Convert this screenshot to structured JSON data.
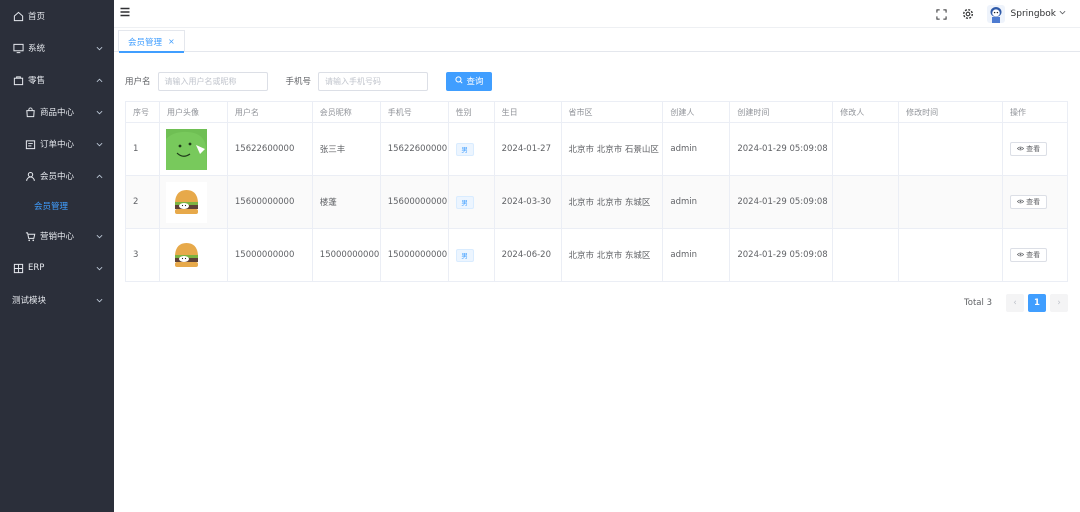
{
  "sidebar": {
    "items": [
      {
        "label": "首页",
        "icon": "home-icon"
      },
      {
        "label": "系统",
        "icon": "monitor-icon"
      },
      {
        "label": "零售",
        "icon": "bag-icon"
      },
      {
        "label": "商品中心",
        "icon": "shop-icon"
      },
      {
        "label": "订单中心",
        "icon": "order-icon"
      },
      {
        "label": "会员中心",
        "icon": "user-icon"
      },
      {
        "label": "会员管理",
        "icon": ""
      },
      {
        "label": "营销中心",
        "icon": "cart-icon"
      },
      {
        "label": "ERP",
        "icon": "erp-icon"
      },
      {
        "label": "测试模块",
        "icon": ""
      }
    ]
  },
  "header": {
    "user_name": "Springbok",
    "icons": [
      "hamburger-icon",
      "fullscreen-icon",
      "settings-icon",
      "chevron-down-icon"
    ]
  },
  "tabs": [
    {
      "label": "会员管理",
      "close": "×"
    }
  ],
  "search": {
    "username_label": "用户名",
    "username_placeholder": "请输入用户名或昵称",
    "phone_label": "手机号",
    "phone_placeholder": "请输入手机号码",
    "button_label": "查询"
  },
  "table": {
    "columns": [
      "序号",
      "用户头像",
      "用户名",
      "会员昵称",
      "手机号",
      "性别",
      "生日",
      "省市区",
      "创建人",
      "创建时间",
      "修改人",
      "修改时间",
      "操作"
    ],
    "rows": [
      {
        "index": "1",
        "avatar": "dino",
        "username": "15622600000",
        "nickname": "张三丰",
        "phone": "15622600000",
        "gender": "男",
        "birthday": "2024-01-27",
        "region": "北京市 北京市 石景山区",
        "creator": "admin",
        "created": "2024-01-29 05:09:08",
        "modifier": "",
        "modified": "",
        "action": "查看"
      },
      {
        "index": "2",
        "avatar": "burger",
        "username": "15600000000",
        "nickname": "楼蓬",
        "phone": "15600000000",
        "gender": "男",
        "birthday": "2024-03-30",
        "region": "北京市 北京市 东城区",
        "creator": "admin",
        "created": "2024-01-29 05:09:08",
        "modifier": "",
        "modified": "",
        "action": "查看"
      },
      {
        "index": "3",
        "avatar": "burger",
        "username": "15000000000",
        "nickname": "15000000000",
        "phone": "15000000000",
        "gender": "男",
        "birthday": "2024-06-20",
        "region": "北京市 北京市 东城区",
        "creator": "admin",
        "created": "2024-01-29 05:09:08",
        "modifier": "",
        "modified": "",
        "action": "查看"
      }
    ]
  },
  "pagination": {
    "total_text": "Total 3",
    "current_page": "1",
    "prev": "‹",
    "next": "›"
  },
  "colors": {
    "primary": "#409eff",
    "sidebar_bg": "#2b2f3a",
    "text": "#606266"
  }
}
